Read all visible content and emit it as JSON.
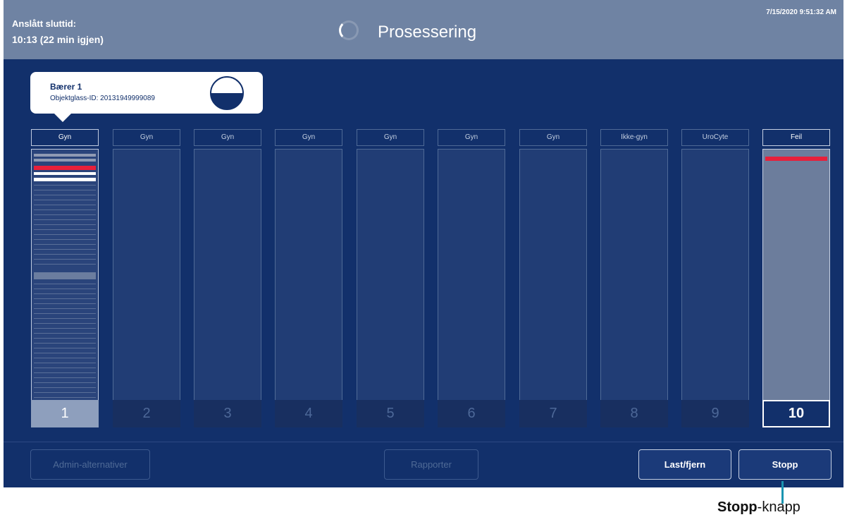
{
  "header": {
    "end_time_label": "Anslått sluttid:",
    "end_time_value": "10:13 (22 min igjen)",
    "title": "Prosessering",
    "timestamp": "7/15/2020 9:51:32 AM",
    "icon": "spinner-icon"
  },
  "callout": {
    "title": "Bærer 1",
    "slide_id": "Objektglass-ID: 20131949999089",
    "level_icon": "half-filled-level-icon"
  },
  "carriers": [
    {
      "tag": "Gyn",
      "number": "1",
      "state": "active"
    },
    {
      "tag": "Gyn",
      "number": "2",
      "state": "empty"
    },
    {
      "tag": "Gyn",
      "number": "3",
      "state": "empty"
    },
    {
      "tag": "Gyn",
      "number": "4",
      "state": "empty"
    },
    {
      "tag": "Gyn",
      "number": "5",
      "state": "empty"
    },
    {
      "tag": "Gyn",
      "number": "6",
      "state": "empty"
    },
    {
      "tag": "Gyn",
      "number": "7",
      "state": "empty"
    },
    {
      "tag": "Ikke-gyn",
      "number": "8",
      "state": "empty"
    },
    {
      "tag": "UroCyte",
      "number": "9",
      "state": "empty"
    },
    {
      "tag": "Feil",
      "number": "10",
      "state": "error"
    }
  ],
  "buttons": {
    "admin": "Admin-alternativer",
    "reports": "Rapporter",
    "load_remove": "Last/fjern",
    "stop": "Stopp"
  },
  "caption": {
    "bold": "Stopp",
    "rest": "-knapp"
  },
  "colors": {
    "screen_bg": "#12306b",
    "header_bg": "#6f83a3",
    "error_marker": "#e8203a",
    "leader_line": "#1a95b1"
  }
}
